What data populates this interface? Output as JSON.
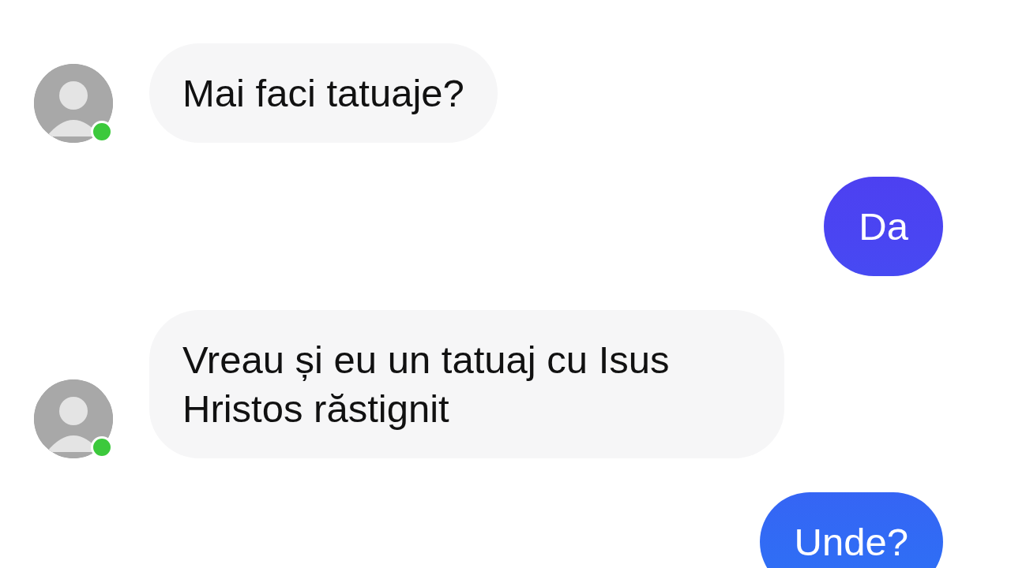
{
  "messages": [
    {
      "kind": "incoming",
      "text": "Mai faci tatuaje?",
      "sender": {
        "online": true
      }
    },
    {
      "kind": "outgoing",
      "text": "Da"
    },
    {
      "kind": "incoming",
      "text": "Vreau și eu un tatuaj cu Isus Hristos răstignit",
      "sender": {
        "online": true
      }
    },
    {
      "kind": "outgoing",
      "text": "Unde?"
    }
  ]
}
